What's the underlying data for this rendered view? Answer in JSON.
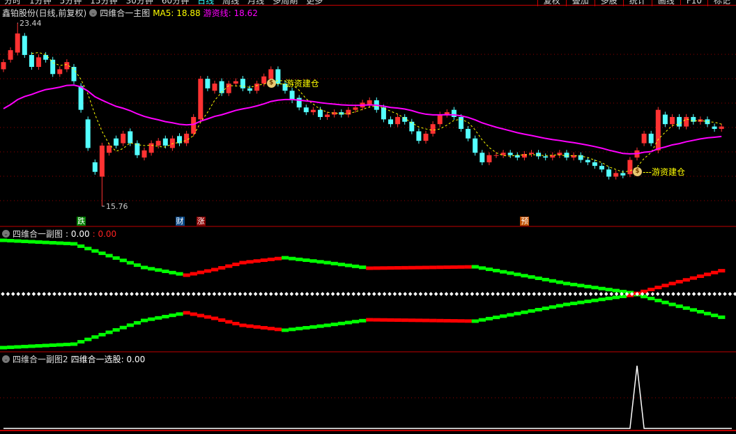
{
  "toolbar": {
    "tabs": [
      "分时",
      "1分钟",
      "5分钟",
      "15分钟",
      "30分钟",
      "60分钟",
      "日线",
      "周线",
      "月线",
      "多周期",
      "更多"
    ],
    "active": "日线",
    "right_buttons": [
      "复权",
      "叠加",
      "多股",
      "统计",
      "画线",
      "F10",
      "标记"
    ]
  },
  "main": {
    "stock": "鑫铂股份(日线,前复权)",
    "indicator": "四维合一主图",
    "ma5_label": "MA5: 18.88",
    "youzi_label": "游资线: 18.62",
    "high_label": "23.44",
    "low_label": "15.76",
    "annotation": "游资建仓",
    "markers": [
      "跌",
      "财",
      "涨",
      "预"
    ],
    "money_bag_icon": "money-bag-icon"
  },
  "sub1": {
    "title": "四维合一副图",
    "v1": ": 0.00",
    "v2": ": 0.00"
  },
  "sub2": {
    "title": "四维合一副图2",
    "v": "四维合一选股: 0.00"
  },
  "colors": {
    "up": "#ff3232",
    "down": "#54ffff",
    "ma5": "#ffff00",
    "youzi": "#ff00ff",
    "bull": "#ff0000",
    "bear": "#00ff00",
    "grid": "#c00000"
  },
  "chart_data": [
    {
      "type": "candlestick",
      "title": "四维合一主图",
      "high": 23.44,
      "low": 15.76,
      "candles_open_close": [
        [
          21.5,
          21.8
        ],
        [
          21.9,
          22.3
        ],
        [
          22.2,
          23.0
        ],
        [
          22.9,
          22.1
        ],
        [
          22.1,
          21.6
        ],
        [
          21.6,
          22.0
        ],
        [
          22.1,
          21.9
        ],
        [
          21.9,
          21.3
        ],
        [
          21.3,
          21.5
        ],
        [
          21.5,
          21.8
        ],
        [
          21.6,
          21.0
        ],
        [
          20.8,
          19.8
        ],
        [
          19.4,
          18.2
        ],
        [
          17.6,
          17.2
        ],
        [
          17.0,
          18.3
        ],
        [
          18.0,
          18.3
        ],
        [
          18.6,
          18.3
        ],
        [
          18.4,
          18.8
        ],
        [
          18.9,
          18.4
        ],
        [
          18.4,
          17.9
        ],
        [
          17.8,
          18.1
        ],
        [
          18.0,
          18.4
        ],
        [
          18.3,
          18.5
        ],
        [
          18.6,
          18.3
        ],
        [
          18.2,
          18.6
        ],
        [
          18.7,
          18.4
        ],
        [
          18.4,
          18.8
        ],
        [
          18.8,
          19.5
        ],
        [
          19.4,
          21.1
        ],
        [
          21.1,
          20.7
        ],
        [
          20.6,
          20.9
        ],
        [
          21.0,
          20.5
        ],
        [
          20.5,
          20.9
        ],
        [
          20.9,
          21.0
        ],
        [
          21.1,
          20.7
        ],
        [
          20.7,
          20.6
        ],
        [
          20.6,
          20.9
        ],
        [
          20.9,
          21.2
        ],
        [
          21.1,
          21.5
        ],
        [
          21.5,
          20.9
        ],
        [
          20.9,
          20.6
        ],
        [
          20.6,
          20.2
        ],
        [
          20.3,
          19.9
        ],
        [
          19.9,
          19.7
        ],
        [
          19.7,
          19.8
        ],
        [
          19.8,
          19.5
        ],
        [
          19.5,
          19.6
        ],
        [
          19.6,
          19.7
        ],
        [
          19.7,
          19.6
        ],
        [
          19.6,
          19.8
        ],
        [
          19.8,
          19.9
        ],
        [
          19.9,
          20.1
        ],
        [
          20.0,
          20.2
        ],
        [
          20.2,
          19.8
        ],
        [
          19.9,
          19.4
        ],
        [
          19.4,
          19.2
        ],
        [
          19.2,
          19.5
        ],
        [
          19.5,
          19.3
        ],
        [
          19.3,
          18.9
        ],
        [
          18.9,
          18.5
        ],
        [
          18.5,
          18.8
        ],
        [
          18.8,
          19.2
        ],
        [
          19.2,
          19.6
        ],
        [
          19.6,
          19.7
        ],
        [
          19.8,
          19.5
        ],
        [
          19.5,
          19.0
        ],
        [
          19.0,
          18.6
        ],
        [
          18.6,
          18.0
        ],
        [
          18.0,
          17.6
        ],
        [
          17.6,
          17.9
        ],
        [
          17.9,
          17.9
        ],
        [
          17.9,
          18.0
        ],
        [
          18.0,
          17.9
        ],
        [
          17.9,
          17.8
        ],
        [
          17.8,
          17.95
        ],
        [
          17.95,
          18.0
        ],
        [
          18.0,
          17.85
        ],
        [
          17.85,
          17.8
        ],
        [
          17.8,
          17.9
        ],
        [
          17.9,
          18.0
        ],
        [
          18.0,
          17.8
        ],
        [
          17.8,
          17.9
        ],
        [
          17.9,
          17.7
        ],
        [
          17.7,
          17.6
        ],
        [
          17.6,
          17.45
        ],
        [
          17.45,
          17.3
        ],
        [
          17.3,
          17.0
        ],
        [
          17.0,
          17.15
        ],
        [
          17.15,
          17.05
        ],
        [
          17.1,
          17.7
        ],
        [
          17.8,
          18.1
        ],
        [
          18.4,
          18.8
        ],
        [
          18.8,
          18.4
        ],
        [
          18.1,
          19.8
        ],
        [
          19.6,
          19.2
        ],
        [
          19.2,
          19.5
        ],
        [
          19.5,
          19.1
        ],
        [
          19.1,
          19.5
        ],
        [
          19.5,
          19.3
        ],
        [
          19.3,
          19.4
        ],
        [
          19.4,
          19.2
        ],
        [
          19.1,
          19.0
        ],
        [
          19.0,
          19.1
        ]
      ],
      "high_index": 2,
      "low_index": 14,
      "markers": [
        {
          "label": "跌",
          "index": 11,
          "color": "#008000"
        },
        {
          "label": "财",
          "index": 25,
          "color": "#0a4a8a"
        },
        {
          "label": "涨",
          "index": 28,
          "color": "#8b0000"
        },
        {
          "label": "预",
          "index": 74,
          "color": "#c05000"
        }
      ],
      "annotations": [
        {
          "text": "游资建仓",
          "index": 38,
          "price": 20.9
        },
        {
          "text": "游资建仓",
          "index": 90,
          "price": 17.2
        }
      ]
    },
    {
      "type": "line",
      "title": "四维合一副图",
      "upper_keypoints": [
        [
          0,
          77
        ],
        [
          10,
          72
        ],
        [
          15,
          55
        ],
        [
          20,
          38
        ],
        [
          26,
          27
        ],
        [
          30,
          35
        ],
        [
          34,
          45
        ],
        [
          40,
          52
        ],
        [
          46,
          45
        ],
        [
          52,
          37
        ],
        [
          60,
          38
        ],
        [
          67,
          39
        ],
        [
          72,
          30
        ],
        [
          80,
          15
        ],
        [
          89,
          2
        ],
        [
          95,
          -15
        ],
        [
          103,
          -36
        ]
      ]
    },
    {
      "type": "line",
      "title": "四维合一选股",
      "values_nonzero": {
        "index": 90,
        "value": 1
      }
    }
  ]
}
